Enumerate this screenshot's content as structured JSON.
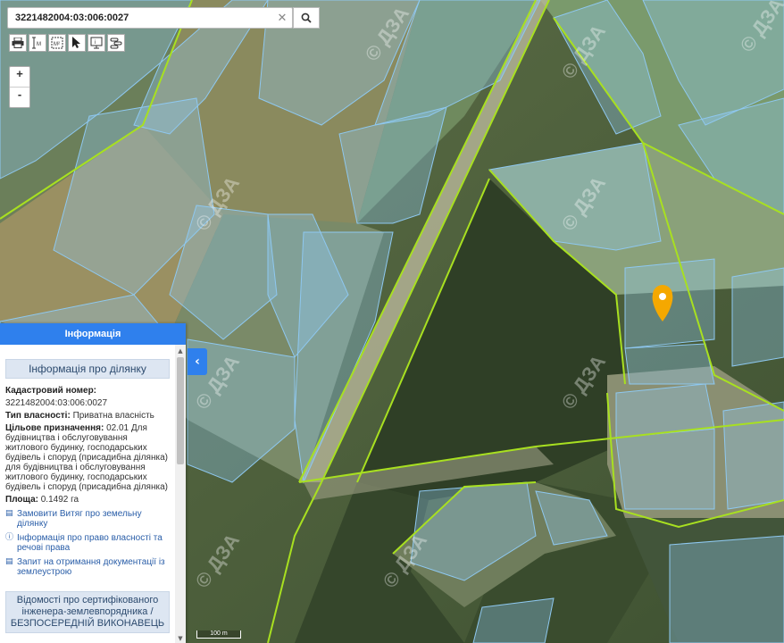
{
  "search": {
    "value": "3221482004:03:006:0027"
  },
  "zoom": {
    "in": "+",
    "out": "-"
  },
  "toolbar": {
    "icons": [
      "printer-icon",
      "measure-line-icon",
      "measure-area-icon",
      "pointer-icon",
      "screen-info-icon",
      "layers-icon"
    ]
  },
  "map": {
    "watermark": "© ДЗА",
    "scale_label": "100 m",
    "marker_color": "#f5a800"
  },
  "panel": {
    "header": "Інформація",
    "section_title": "Інформація про ділянку",
    "cadastral_label": "Кадастровий номер:",
    "cadastral_value": "3221482004:03:006:0027",
    "ownership_label": "Тип власності:",
    "ownership_value": "Приватна власність",
    "purpose_label": "Цільове призначення:",
    "purpose_value": "02.01 Для будівництва і обслуговування житлового будинку, господарських будівель і споруд (присадибна ділянка) для будівництва і обслуговування житлового будинку, господарських будівель і споруд (присадибна ділянка)",
    "area_label": "Площа:",
    "area_value": "0.1492 га",
    "links": [
      "Замовити Витяг про земельну ділянку",
      "Інформація про право власності та речові права",
      "Запит на отримання документації із землеустрою"
    ],
    "engineer": "Відомості про сертифікованого інженера-землевпорядника / БЕЗПОСЕРЕДНІЙ ВИКОНАВЕЦЬ"
  },
  "colors": {
    "accent": "#2f80ed",
    "parcel": "#8ec8f0",
    "boundary": "#a8e020"
  }
}
